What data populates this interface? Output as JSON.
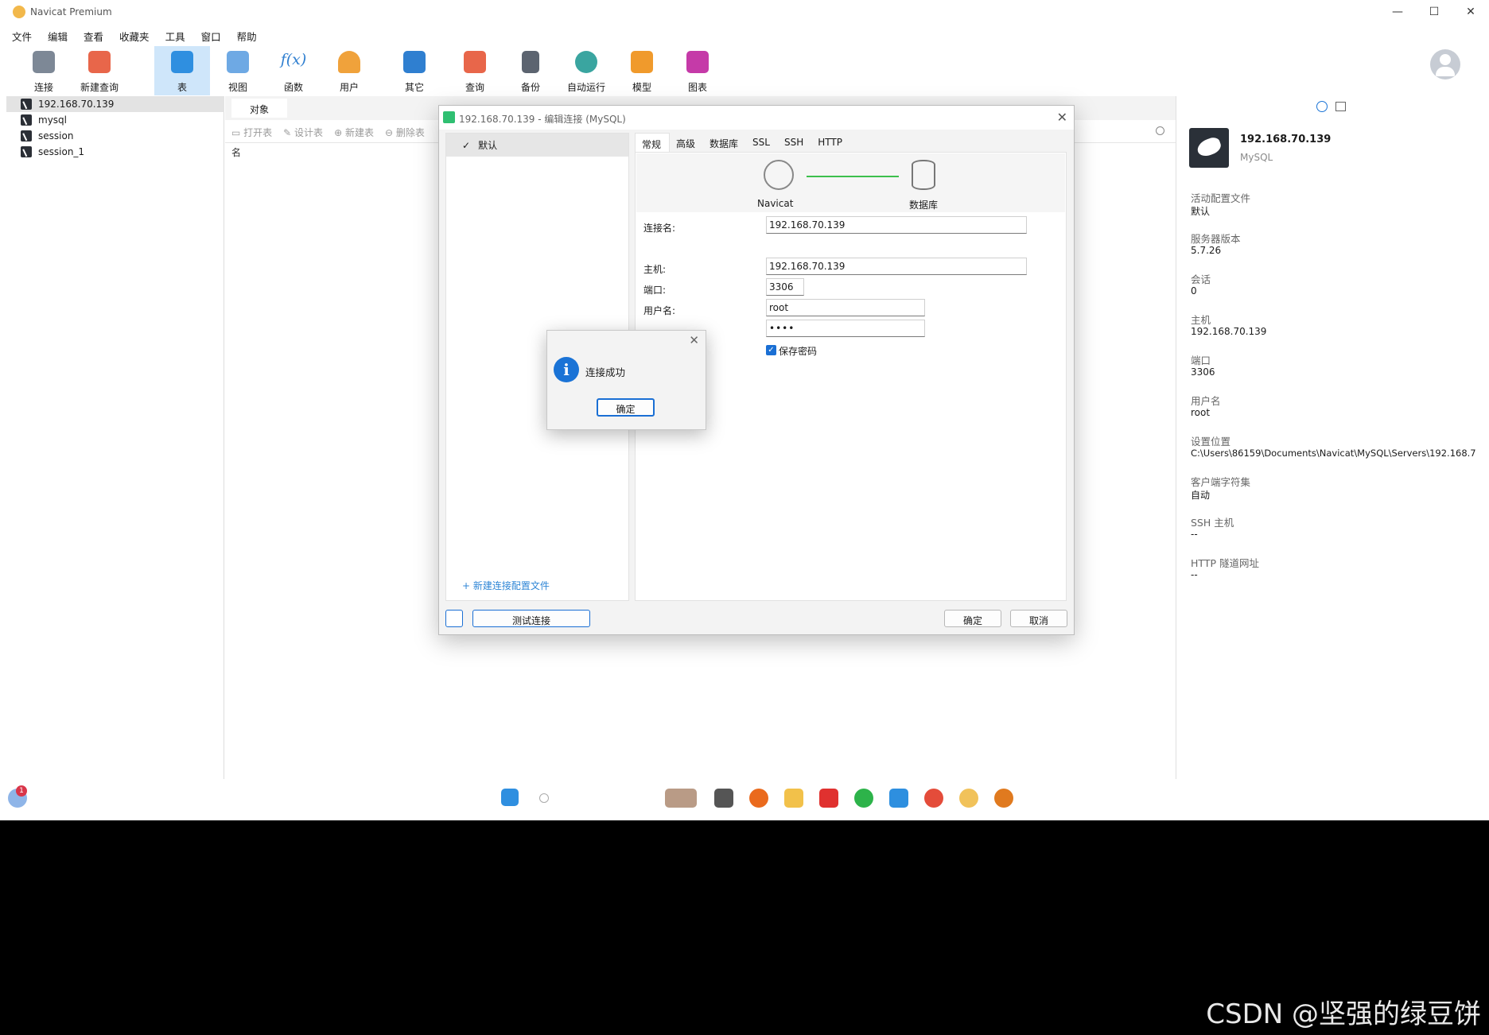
{
  "window": {
    "title": "Navicat Premium",
    "min": "—",
    "max": "☐",
    "close": "✕"
  },
  "menu": [
    "文件",
    "编辑",
    "查看",
    "收藏夹",
    "工具",
    "窗口",
    "帮助"
  ],
  "toolbar": [
    {
      "label": "连接",
      "icon": "plug-icon"
    },
    {
      "label": "新建查询",
      "icon": "new-query-icon"
    },
    {
      "label": "表",
      "icon": "table-icon",
      "active": true
    },
    {
      "label": "视图",
      "icon": "view-icon"
    },
    {
      "label": "函数",
      "icon": "function-icon"
    },
    {
      "label": "用户",
      "icon": "user-icon"
    },
    {
      "label": "其它",
      "icon": "tools-icon"
    },
    {
      "label": "查询",
      "icon": "query-icon"
    },
    {
      "label": "备份",
      "icon": "backup-icon"
    },
    {
      "label": "自动运行",
      "icon": "robot-icon"
    },
    {
      "label": "模型",
      "icon": "model-icon"
    },
    {
      "label": "图表",
      "icon": "chart-icon"
    }
  ],
  "fx_text": "f(x)",
  "tree": [
    "192.168.70.139",
    "mysql",
    "session",
    "session_1"
  ],
  "center": {
    "tab": "对象",
    "tools": [
      "打开表",
      "设计表",
      "新建表",
      "删除表"
    ],
    "col_header": "名"
  },
  "right_panel": {
    "name": "192.168.70.139",
    "type": "MySQL",
    "fields": [
      {
        "k": "活动配置文件",
        "v": "默认"
      },
      {
        "k": "服务器版本",
        "v": "5.7.26"
      },
      {
        "k": "会话",
        "v": "0"
      },
      {
        "k": "主机",
        "v": "192.168.70.139"
      },
      {
        "k": "端口",
        "v": "3306"
      },
      {
        "k": "用户名",
        "v": "root"
      },
      {
        "k": "设置位置",
        "v": "C:\\Users\\86159\\Documents\\Navicat\\MySQL\\Servers\\192.168.7"
      },
      {
        "k": "客户端字符集",
        "v": "自动"
      },
      {
        "k": "SSH 主机",
        "v": "--"
      },
      {
        "k": "HTTP 隧道网址",
        "v": "--"
      }
    ]
  },
  "dialog": {
    "title": "192.168.70.139 - 编辑连接 (MySQL)",
    "profile": "默认",
    "new_profile": "+ 新建连接配置文件",
    "tabs": [
      "常规",
      "高级",
      "数据库",
      "SSL",
      "SSH",
      "HTTP"
    ],
    "graph_left": "Navicat",
    "graph_right": "数据库",
    "fields": {
      "conn_name_label": "连接名:",
      "conn_name": "192.168.70.139",
      "host_label": "主机:",
      "host": "192.168.70.139",
      "port_label": "端口:",
      "port": "3306",
      "user_label": "用户名:",
      "user": "root",
      "password": "••••",
      "save_password": "保存密码"
    },
    "test_button": "测试连接",
    "ok_button": "确定",
    "cancel_button": "取消"
  },
  "message": {
    "text": "连接成功",
    "ok": "确定",
    "icon": "i"
  },
  "taskbar": {
    "badge": "1"
  },
  "watermark": "CSDN @坚强的绿豆饼"
}
